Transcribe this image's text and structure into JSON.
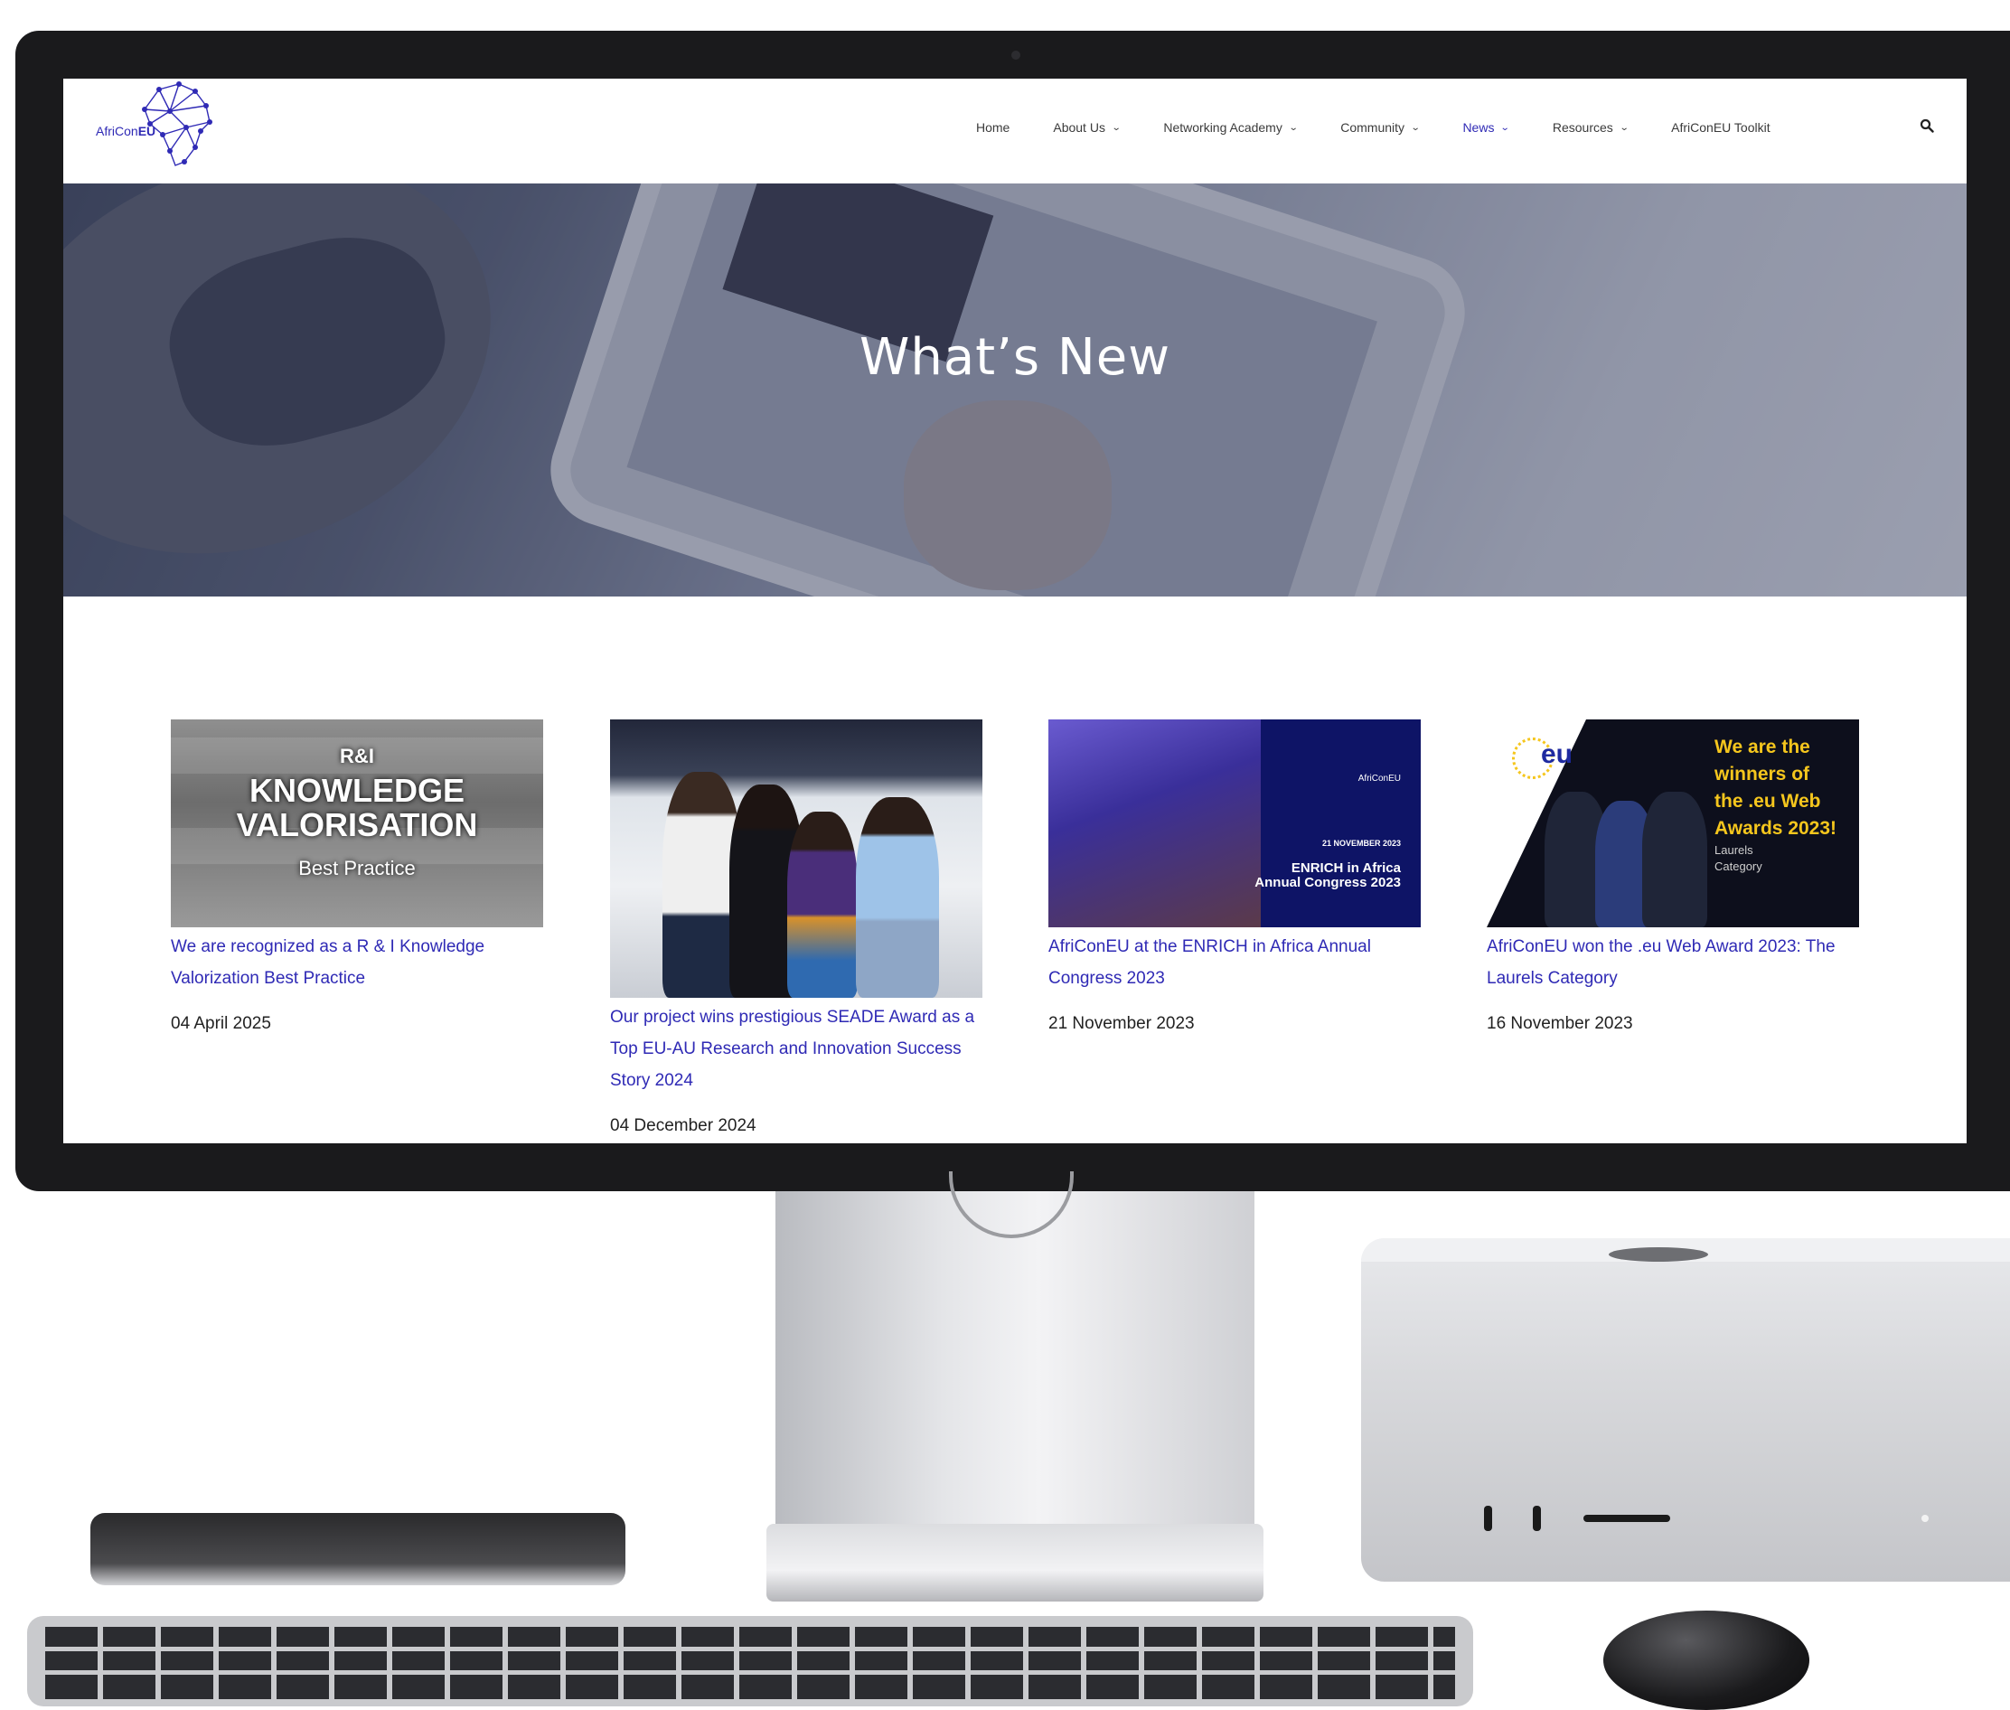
{
  "site": {
    "logo": {
      "prefix": "AfriCon",
      "suffix": "EU"
    },
    "nav": [
      {
        "label": "Home",
        "has_dropdown": false
      },
      {
        "label": "About Us",
        "has_dropdown": true
      },
      {
        "label": "Networking Academy",
        "has_dropdown": true
      },
      {
        "label": "Community",
        "has_dropdown": true
      },
      {
        "label": "News",
        "has_dropdown": true,
        "active": true
      },
      {
        "label": "Resources",
        "has_dropdown": true
      },
      {
        "label": "AfriConEU Toolkit",
        "has_dropdown": false
      }
    ],
    "search_icon": "search-icon",
    "chevron_glyph": "⌄"
  },
  "hero": {
    "title": "What’s New"
  },
  "news": [
    {
      "thumb": {
        "line1": "R&I",
        "line2": "KNOWLEDGE",
        "line3": "VALORISATION",
        "line4": "Best Practice"
      },
      "title": "We are recognized as a R & I Knowledge Valorization Best Practice",
      "date": "04 April 2025"
    },
    {
      "title": "Our project wins prestigious SEADE Award as a Top EU-AU Research and Innovation Success Story 2024",
      "date": "04 December 2024"
    },
    {
      "thumb": {
        "date_line": "21 NOVEMBER 2023",
        "event_line1": "ENRICH in Africa",
        "event_line2": "Annual Congress 2023",
        "logo": "AfriConEU"
      },
      "title": "AfriConEU at the ENRICH in Africa Annual Congress 2023",
      "date": "21 November 2023"
    },
    {
      "thumb": {
        "eu": "eu",
        "line1": "We are the",
        "line2": "winners of",
        "line3": "the .eu Web",
        "line4": "Awards 2023!",
        "small1": "Laurels",
        "small2": "Category"
      },
      "title": "AfriConEU won the .eu Web Award 2023: The Laurels Category",
      "date": "16 November 2023"
    }
  ],
  "colors": {
    "accent": "#2f2ab5",
    "monitor_bezel": "#1a1a1c",
    "award_yellow": "#f5c61d"
  }
}
